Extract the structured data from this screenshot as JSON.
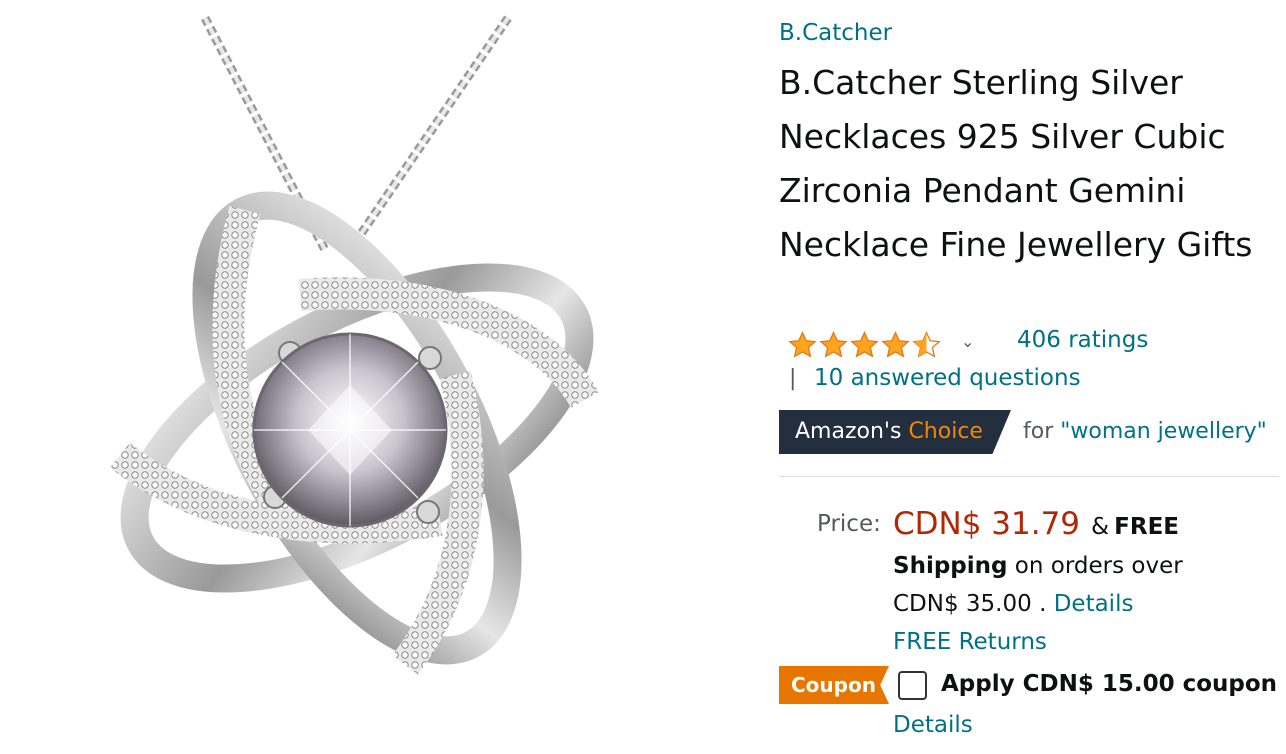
{
  "product": {
    "brand": "B.Catcher",
    "title": "B.Catcher Sterling Silver Necklaces 925 Silver Cubic Zirconia Pendant Gemini Necklace Fine Jewellery Gifts",
    "rating_value": 4.5,
    "ratings_text": "406 ratings",
    "separator": "|",
    "questions_text": "10 answered questions",
    "image_icon": "necklace-pendant-image"
  },
  "badge": {
    "label_prefix": "Amazon's",
    "label_highlight": "Choice",
    "for_text": "for",
    "keyword": "\"woman jewellery\""
  },
  "price": {
    "label": "Price:",
    "amount": "CDN$ 31.79",
    "amp": "&",
    "free": "FREE",
    "shipping_bold": "Shipping",
    "shipping_rest": "on orders over",
    "minimum": "CDN$ 35.00 .",
    "details": "Details",
    "returns": "FREE Returns"
  },
  "coupon": {
    "badge": "Coupon",
    "apply_text": "Apply CDN$ 15.00 coupon",
    "details": "Details",
    "checked": false
  },
  "colors": {
    "link": "#007185",
    "price": "#b12704",
    "choice_bg": "#232f3e",
    "choice_accent": "#f08804",
    "coupon_bg": "#e77600",
    "star": "#ffa41c"
  }
}
